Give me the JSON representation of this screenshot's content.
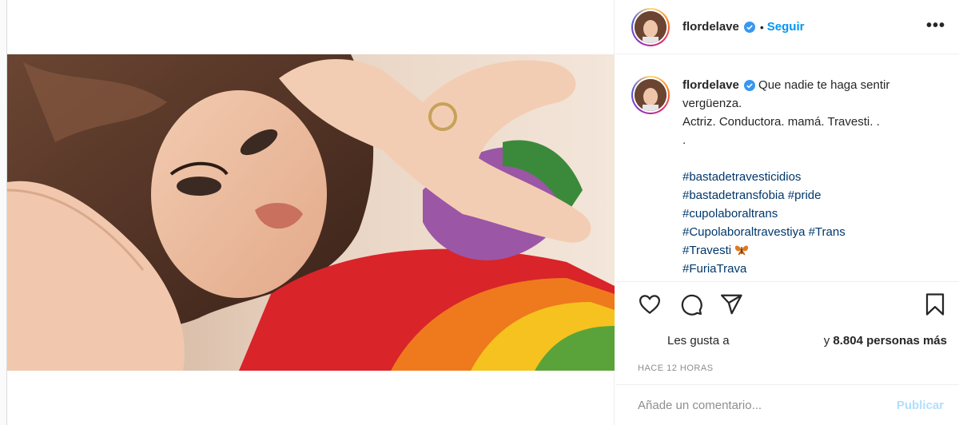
{
  "post": {
    "username": "flordelave",
    "follow_label": "Seguir",
    "dot": "•",
    "more_label": "•••",
    "icons": [
      "verified-badge-icon",
      "more-options-icon",
      "heart-icon",
      "comment-icon",
      "share-icon",
      "bookmark-icon"
    ]
  },
  "caption": {
    "username": "flordelave",
    "line1": " Que nadie te haga sentir vergüenza.",
    "line2": "Actriz. Conductora. mamá. Travesti. .",
    "line3": ".",
    "tags": [
      "#bastadetravesticidios",
      "#bastadetransfobia",
      "#pride",
      "#cupolaboraltrans",
      "#Cupolaboraltravestiya",
      "#Trans",
      "#Travesti",
      "#FuriaTrava"
    ],
    "butterfly_icon": "butterfly-emoji"
  },
  "likes": {
    "prefix": "Les gusta a",
    "suffix_pre": "y ",
    "count": "8.804 personas más"
  },
  "time": "HACE 12 HORAS",
  "comment": {
    "placeholder": "Añade un comentario...",
    "publish_label": "Publicar"
  },
  "colors": {
    "link_blue": "#0095f6",
    "hashtag": "#00376b",
    "publish_disabled": "#b2dffc",
    "muted": "#8e8e8e"
  }
}
